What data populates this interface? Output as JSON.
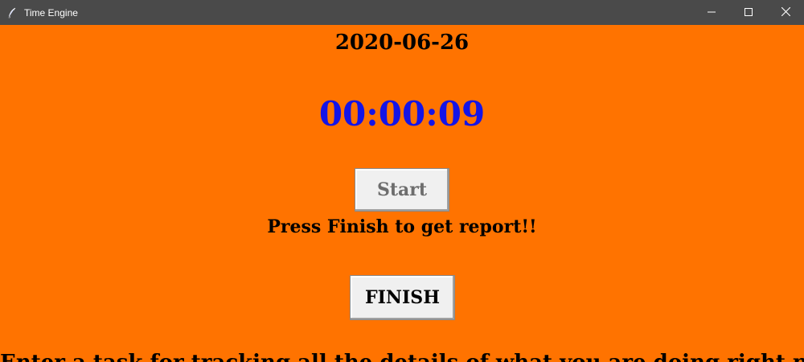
{
  "window": {
    "title": "Time Engine",
    "icon": "feather-icon"
  },
  "colors": {
    "background": "#ff7300",
    "timer": "#1414e6",
    "titlebar": "#4a4a4a"
  },
  "main": {
    "date": "2020-06-26",
    "timer": "00:00:09",
    "start_label": "Start",
    "prompt": "Press Finish to get report!!",
    "finish_label": "FINISH",
    "bottom_text": "Enter a task for tracking all the details of what you are doing right now"
  }
}
